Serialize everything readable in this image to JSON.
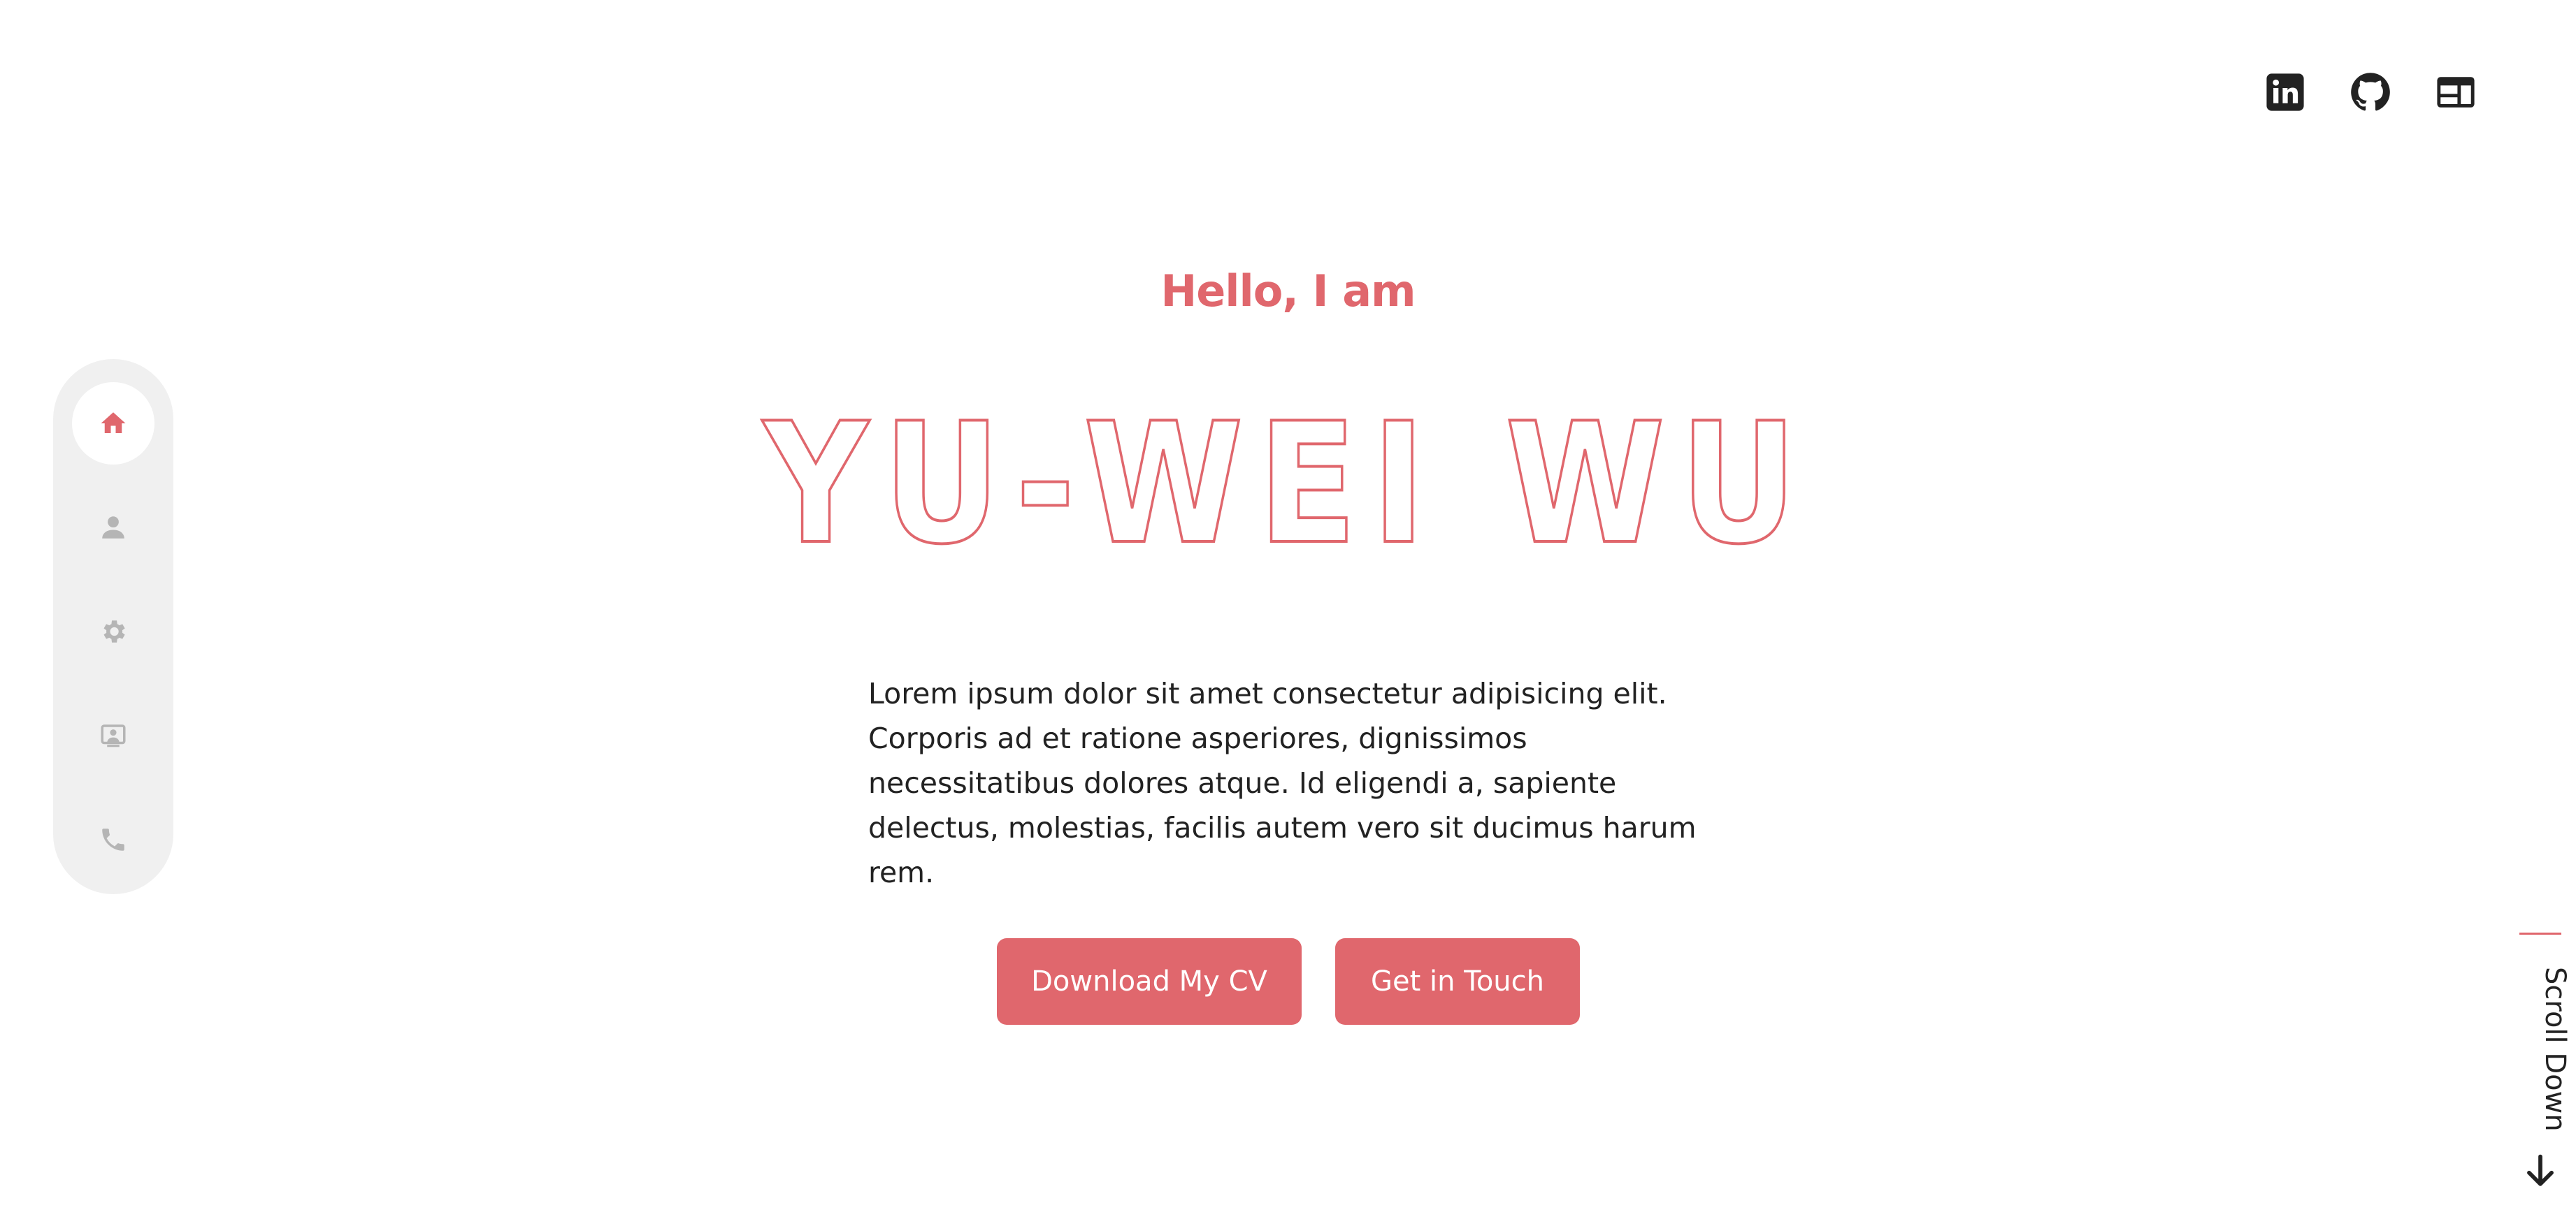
{
  "header": {
    "socials": [
      {
        "name": "linkedin-icon"
      },
      {
        "name": "github-icon"
      },
      {
        "name": "website-icon"
      }
    ]
  },
  "sidenav": {
    "items": [
      {
        "name": "home-icon",
        "active": true
      },
      {
        "name": "person-icon",
        "active": false
      },
      {
        "name": "gear-icon",
        "active": false
      },
      {
        "name": "portfolio-icon",
        "active": false
      },
      {
        "name": "phone-icon",
        "active": false
      }
    ]
  },
  "hero": {
    "greeting": "Hello, I am",
    "name": "YU-WEI WU",
    "intro": "Lorem ipsum dolor sit amet consectetur adipisicing elit. Corporis ad et ratione asperiores, dignissimos necessitatibus dolores atque. Id eligendi a, sapiente delectus, molestias, facilis autem vero sit ducimus harum rem."
  },
  "actions": {
    "download_cv": "Download My CV",
    "get_in_touch": "Get in Touch"
  },
  "scroll": {
    "label": "Scroll Down"
  },
  "colors": {
    "accent": "#e0676d",
    "text": "#222222",
    "inactive_icon": "#b5b5b5",
    "nav_bg": "#f0f0f0"
  }
}
